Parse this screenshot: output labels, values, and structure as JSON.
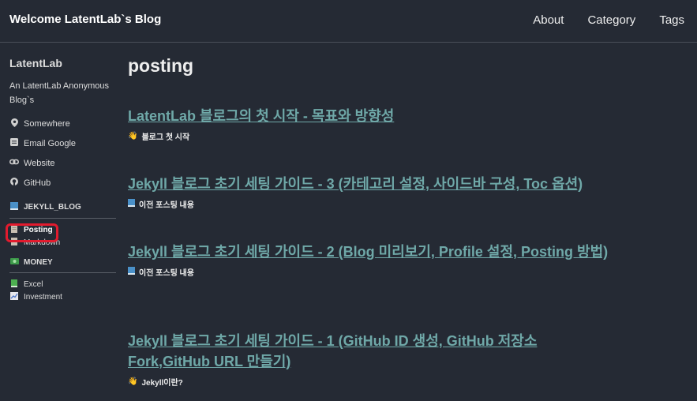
{
  "header": {
    "site_title": "Welcome LatentLab`s Blog",
    "nav": [
      {
        "label": "About"
      },
      {
        "label": "Category"
      },
      {
        "label": "Tags"
      }
    ]
  },
  "sidebar": {
    "author_name": "LatentLab",
    "author_bio": "An LatentLab Anonymous Blog`s",
    "links": [
      {
        "icon": "location-pin-icon",
        "label": "Somewhere"
      },
      {
        "icon": "email-icon",
        "label": "Email Google"
      },
      {
        "icon": "link-icon",
        "label": "Website"
      },
      {
        "icon": "github-icon",
        "label": "GitHub"
      }
    ],
    "categories": [
      {
        "title": "JEKYLL_BLOG",
        "icon": "book-icon",
        "items": [
          {
            "label": "Posting",
            "icon": "document-icon",
            "active": true
          },
          {
            "label": "Markdown",
            "icon": "document-icon",
            "active": false
          }
        ]
      },
      {
        "title": "MONEY",
        "icon": "money-icon",
        "items": [
          {
            "label": "Excel",
            "icon": "green-book-icon",
            "active": false
          },
          {
            "label": "Investment",
            "icon": "chart-icon",
            "active": false
          }
        ]
      }
    ]
  },
  "main": {
    "page_title": "posting",
    "posts": [
      {
        "title": "LatentLab 블로그의 첫 시작 - 목표와 방향성",
        "excerpt_icon": "waving-hand-icon",
        "excerpt": "블로그 첫 시작"
      },
      {
        "title": "Jekyll 블로그 초기 세팅 가이드 - 3 (카테고리 설정, 사이드바 구성, Toc 옵션)",
        "excerpt_icon": "blue-book-icon",
        "excerpt": "이전 포스팅 내용"
      },
      {
        "title": "Jekyll 블로그 초기 세팅 가이드 - 2 (Blog 미리보기, Profile 설정, Posting 방법)",
        "excerpt_icon": "blue-book-icon",
        "excerpt": "이전 포스팅 내용"
      },
      {
        "title": "Jekyll 블로그 초기 세팅 가이드 - 1 (GitHub ID 생성, GitHub 저장소 Fork,GitHub URL 만들기)",
        "excerpt_icon": "waving-hand-icon",
        "excerpt": "Jekyll이란?"
      }
    ]
  },
  "colors": {
    "background": "#252a34",
    "link": "#6fa8a8",
    "highlight": "#e21b2e"
  }
}
